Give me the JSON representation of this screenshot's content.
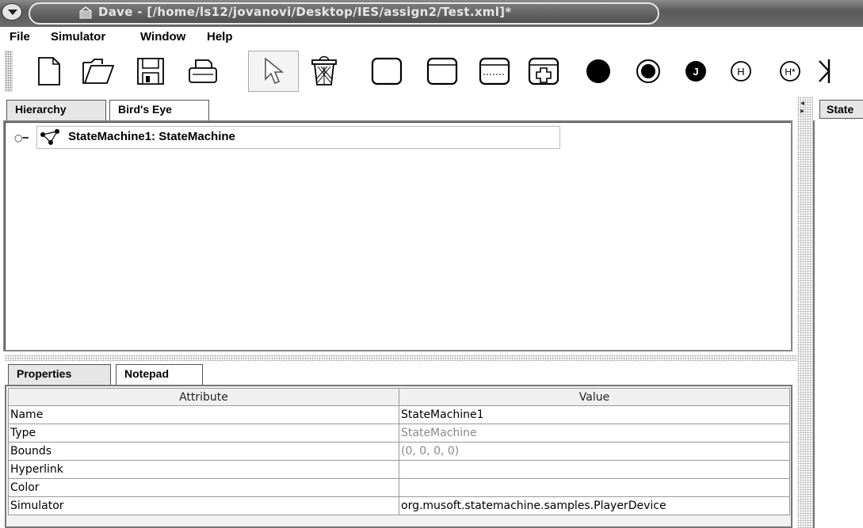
{
  "window": {
    "title": "Dave - [/home/ls12/jovanovi/Desktop/IES/assign2/Test.xml]*"
  },
  "menubar": {
    "items": [
      {
        "label": "File",
        "mnemonic": "F"
      },
      {
        "label": "Simulator",
        "mnemonic": "S"
      },
      {
        "label": "Window",
        "mnemonic": ""
      },
      {
        "label": "Help",
        "mnemonic": "H"
      }
    ]
  },
  "toolbar": {
    "tools": [
      {
        "name": "new-file-icon"
      },
      {
        "name": "open-folder-icon"
      },
      {
        "name": "save-disk-icon"
      },
      {
        "name": "print-icon"
      },
      {
        "name": "select-arrow-icon",
        "pressed": true
      },
      {
        "name": "trash-icon"
      },
      {
        "name": "simple-state-icon"
      },
      {
        "name": "composite-state-icon"
      },
      {
        "name": "concurrent-state-icon"
      },
      {
        "name": "submachine-state-icon"
      },
      {
        "name": "initial-state-icon"
      },
      {
        "name": "final-state-icon"
      },
      {
        "name": "junction-icon",
        "glyph": "J"
      },
      {
        "name": "shallow-history-icon",
        "glyph": "H"
      },
      {
        "name": "deep-history-icon",
        "glyph": "H*"
      },
      {
        "name": "transition-icon"
      }
    ]
  },
  "top_tabs": [
    {
      "label": "Hierarchy",
      "active": true
    },
    {
      "label": "Bird's Eye",
      "active": false
    }
  ],
  "tree": {
    "root_label": "StateMachine1: StateMachine"
  },
  "bottom_tabs": [
    {
      "label": "Properties",
      "active": true
    },
    {
      "label": "Notepad",
      "active": false
    }
  ],
  "properties": {
    "headers": {
      "attribute": "Attribute",
      "value": "Value"
    },
    "rows": [
      {
        "attribute": "Name",
        "value": "StateMachine1",
        "readonly": false
      },
      {
        "attribute": "Type",
        "value": "StateMachine",
        "readonly": true
      },
      {
        "attribute": "Bounds",
        "value": "(0, 0, 0, 0)",
        "readonly": true
      },
      {
        "attribute": "Hyperlink",
        "value": "",
        "readonly": false
      },
      {
        "attribute": "Color",
        "value": "",
        "readonly": false
      },
      {
        "attribute": "Simulator",
        "value": "org.musoft.statemachine.samples.PlayerDevice",
        "readonly": false
      }
    ]
  },
  "right_panel": {
    "tab_label": "State"
  }
}
